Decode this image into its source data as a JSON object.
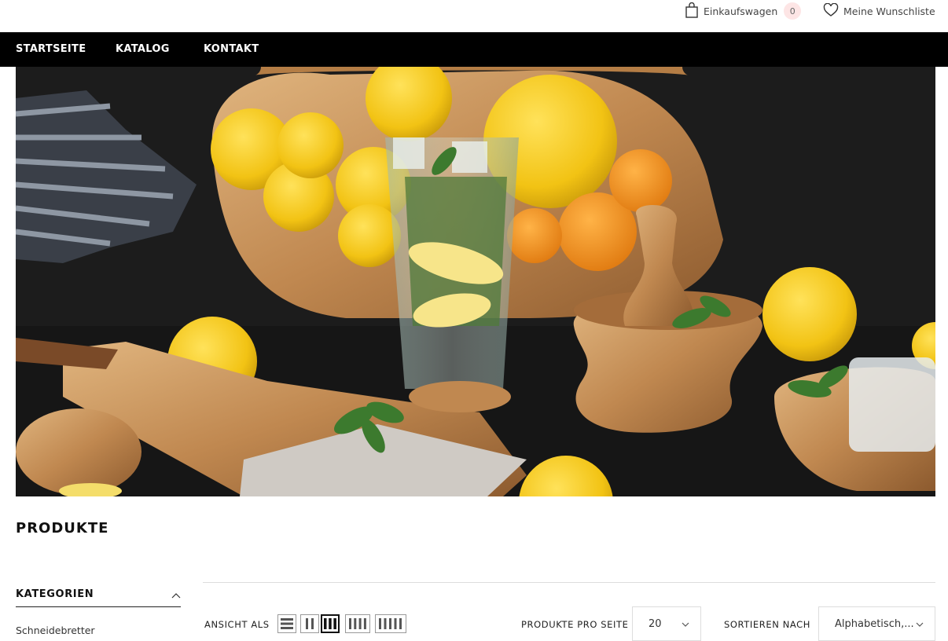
{
  "header": {
    "cart_label": "Einkaufswagen",
    "cart_count": "0",
    "wishlist_label": "Meine Wunschliste"
  },
  "nav": {
    "items": [
      "STARTSEITE",
      "KATALOG",
      "KONTAKT"
    ]
  },
  "hero": {
    "icon": "hero-banner-image",
    "description_colors": {
      "background": "#1b1b1b",
      "lemon": "#f2c314",
      "wood": "#c9925a"
    }
  },
  "page": {
    "title": "PRODUKTE"
  },
  "sidebar": {
    "categories_title": "KATEGORIEN",
    "categories": [
      "Schneidebretter"
    ]
  },
  "toolbar": {
    "view_label": "ANSICHT ALS",
    "per_page_label": "PRODUKTE PRO SEITE",
    "per_page_value": "20",
    "sort_label": "SORTIEREN NACH",
    "sort_value": "Alphabetisch,..."
  },
  "colors": {
    "nav_bg": "#000000",
    "badge_bg": "#fde5e5"
  }
}
